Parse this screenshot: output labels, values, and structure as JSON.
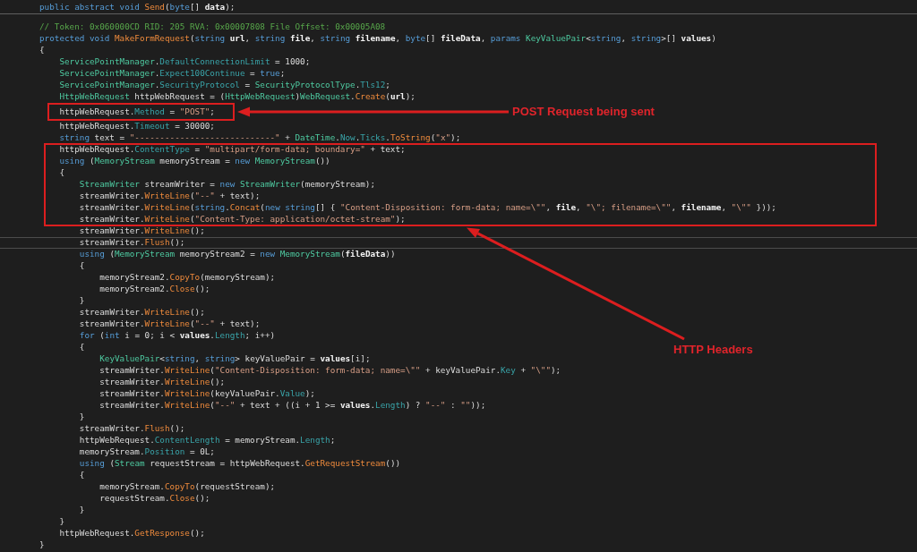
{
  "members": [
    {
      "lines": [
        {
          "tokens": [
            {
              "kind": "keyword",
              "text": "public abstract void "
            },
            {
              "kind": "method",
              "text": "Send"
            },
            {
              "kind": "plain",
              "text": "("
            },
            {
              "kind": "keyword",
              "text": "byte"
            },
            {
              "kind": "plain",
              "text": "[] "
            },
            {
              "kind": "parameter",
              "text": "data"
            },
            {
              "kind": "plain",
              "text": ");"
            }
          ],
          "current": false
        }
      ]
    },
    {
      "lines": [
        {
          "tokens": [
            {
              "kind": "comment",
              "text": "// Token: 0x060000CD RID: 205 RVA: 0x00007808 File Offset: 0x00005A08"
            }
          ],
          "current": false
        },
        {
          "tokens": [
            {
              "kind": "keyword",
              "text": "protected void "
            },
            {
              "kind": "method",
              "text": "MakeFormRequest"
            },
            {
              "kind": "plain",
              "text": "("
            },
            {
              "kind": "keyword",
              "text": "string "
            },
            {
              "kind": "parameter",
              "text": "url"
            },
            {
              "kind": "plain",
              "text": ", "
            },
            {
              "kind": "keyword",
              "text": "string "
            },
            {
              "kind": "parameter",
              "text": "file"
            },
            {
              "kind": "plain",
              "text": ", "
            },
            {
              "kind": "keyword",
              "text": "string "
            },
            {
              "kind": "parameter",
              "text": "filename"
            },
            {
              "kind": "plain",
              "text": ", "
            },
            {
              "kind": "keyword",
              "text": "byte"
            },
            {
              "kind": "plain",
              "text": "[] "
            },
            {
              "kind": "parameter",
              "text": "fileData"
            },
            {
              "kind": "plain",
              "text": ", "
            },
            {
              "kind": "keyword",
              "text": "params "
            },
            {
              "kind": "type",
              "text": "KeyValuePair"
            },
            {
              "kind": "plain",
              "text": "<"
            },
            {
              "kind": "keyword",
              "text": "string"
            },
            {
              "kind": "plain",
              "text": ", "
            },
            {
              "kind": "keyword",
              "text": "string"
            },
            {
              "kind": "plain",
              "text": ">[] "
            },
            {
              "kind": "parameter",
              "text": "values"
            },
            {
              "kind": "plain",
              "text": ")"
            }
          ],
          "current": false
        },
        {
          "tokens": [
            {
              "kind": "plain",
              "text": "{"
            }
          ],
          "current": false,
          "children": [
            {
              "tokens": [
                {
                  "kind": "type",
                  "text": "ServicePointManager"
                },
                {
                  "kind": "plain",
                  "text": "."
                },
                {
                  "kind": "property",
                  "text": "DefaultConnectionLimit"
                },
                {
                  "kind": "plain",
                  "text": " = 1000;"
                }
              ],
              "current": false
            },
            {
              "tokens": [
                {
                  "kind": "type",
                  "text": "ServicePointManager"
                },
                {
                  "kind": "plain",
                  "text": "."
                },
                {
                  "kind": "property",
                  "text": "Expect100Continue"
                },
                {
                  "kind": "plain",
                  "text": " = "
                },
                {
                  "kind": "keyword",
                  "text": "true"
                },
                {
                  "kind": "plain",
                  "text": ";"
                }
              ],
              "current": false
            },
            {
              "tokens": [
                {
                  "kind": "type",
                  "text": "ServicePointManager"
                },
                {
                  "kind": "plain",
                  "text": "."
                },
                {
                  "kind": "property",
                  "text": "SecurityProtocol"
                },
                {
                  "kind": "plain",
                  "text": " = "
                },
                {
                  "kind": "type",
                  "text": "SecurityProtocolType"
                },
                {
                  "kind": "plain",
                  "text": "."
                },
                {
                  "kind": "property",
                  "text": "Tls12"
                },
                {
                  "kind": "plain",
                  "text": ";"
                }
              ],
              "current": false
            },
            {
              "tokens": [
                {
                  "kind": "type",
                  "text": "HttpWebRequest"
                },
                {
                  "kind": "plain",
                  "text": " httpWebRequest = ("
                },
                {
                  "kind": "type",
                  "text": "HttpWebRequest"
                },
                {
                  "kind": "plain",
                  "text": ")"
                },
                {
                  "kind": "type",
                  "text": "WebRequest"
                },
                {
                  "kind": "plain",
                  "text": "."
                },
                {
                  "kind": "method",
                  "text": "Create"
                },
                {
                  "kind": "plain",
                  "text": "("
                },
                {
                  "kind": "parameter",
                  "text": "url"
                },
                {
                  "kind": "plain",
                  "text": ");"
                }
              ],
              "current": false
            },
            {
              "tokens": [
                {
                  "kind": "plain",
                  "text": "httpWebRequest."
                },
                {
                  "kind": "property",
                  "text": "Method"
                },
                {
                  "kind": "plain",
                  "text": " = "
                },
                {
                  "kind": "string",
                  "text": "\"POST\""
                },
                {
                  "kind": "plain",
                  "text": ";"
                }
              ],
              "current": false
            },
            {
              "tokens": [
                {
                  "kind": "plain",
                  "text": "httpWebRequest."
                },
                {
                  "kind": "property",
                  "text": "Timeout"
                },
                {
                  "kind": "plain",
                  "text": " = 30000;"
                }
              ],
              "current": false
            },
            {
              "tokens": [
                {
                  "kind": "keyword",
                  "text": "string"
                },
                {
                  "kind": "plain",
                  "text": " text = "
                },
                {
                  "kind": "string",
                  "text": "\"----------------------------\""
                },
                {
                  "kind": "plain",
                  "text": " + "
                },
                {
                  "kind": "type",
                  "text": "DateTime"
                },
                {
                  "kind": "plain",
                  "text": "."
                },
                {
                  "kind": "property",
                  "text": "Now"
                },
                {
                  "kind": "plain",
                  "text": "."
                },
                {
                  "kind": "property",
                  "text": "Ticks"
                },
                {
                  "kind": "plain",
                  "text": "."
                },
                {
                  "kind": "method",
                  "text": "ToString"
                },
                {
                  "kind": "plain",
                  "text": "("
                },
                {
                  "kind": "string",
                  "text": "\"x\""
                },
                {
                  "kind": "plain",
                  "text": ");"
                }
              ],
              "current": false
            },
            {
              "tokens": [
                {
                  "kind": "plain",
                  "text": "httpWebRequest."
                },
                {
                  "kind": "property",
                  "text": "ContentType"
                },
                {
                  "kind": "plain",
                  "text": " = "
                },
                {
                  "kind": "string",
                  "text": "\"multipart/form-data; boundary=\""
                },
                {
                  "kind": "plain",
                  "text": " + text;"
                }
              ],
              "current": false
            },
            {
              "tokens": [
                {
                  "kind": "keyword",
                  "text": "using"
                },
                {
                  "kind": "plain",
                  "text": " ("
                },
                {
                  "kind": "type",
                  "text": "MemoryStream"
                },
                {
                  "kind": "plain",
                  "text": " memoryStream = "
                },
                {
                  "kind": "keyword",
                  "text": "new "
                },
                {
                  "kind": "type",
                  "text": "MemoryStream"
                },
                {
                  "kind": "plain",
                  "text": "())"
                }
              ],
              "current": false
            },
            {
              "tokens": [
                {
                  "kind": "plain",
                  "text": "{"
                }
              ],
              "current": false,
              "children": [
                {
                  "tokens": [
                    {
                      "kind": "type",
                      "text": "StreamWriter"
                    },
                    {
                      "kind": "plain",
                      "text": " streamWriter = "
                    },
                    {
                      "kind": "keyword",
                      "text": "new "
                    },
                    {
                      "kind": "type",
                      "text": "StreamWriter"
                    },
                    {
                      "kind": "plain",
                      "text": "(memoryStream);"
                    }
                  ],
                  "current": false
                },
                {
                  "tokens": [
                    {
                      "kind": "plain",
                      "text": "streamWriter."
                    },
                    {
                      "kind": "method",
                      "text": "WriteLine"
                    },
                    {
                      "kind": "plain",
                      "text": "("
                    },
                    {
                      "kind": "string",
                      "text": "\"--\""
                    },
                    {
                      "kind": "plain",
                      "text": " + text);"
                    }
                  ],
                  "current": false
                },
                {
                  "tokens": [
                    {
                      "kind": "plain",
                      "text": "streamWriter."
                    },
                    {
                      "kind": "method",
                      "text": "WriteLine"
                    },
                    {
                      "kind": "plain",
                      "text": "("
                    },
                    {
                      "kind": "keyword",
                      "text": "string"
                    },
                    {
                      "kind": "plain",
                      "text": "."
                    },
                    {
                      "kind": "method",
                      "text": "Concat"
                    },
                    {
                      "kind": "plain",
                      "text": "("
                    },
                    {
                      "kind": "keyword",
                      "text": "new string"
                    },
                    {
                      "kind": "plain",
                      "text": "[] { "
                    },
                    {
                      "kind": "string",
                      "text": "\"Content-Disposition: form-data; name=\\\"\""
                    },
                    {
                      "kind": "plain",
                      "text": ", "
                    },
                    {
                      "kind": "parameter",
                      "text": "file"
                    },
                    {
                      "kind": "plain",
                      "text": ", "
                    },
                    {
                      "kind": "string",
                      "text": "\"\\\"; filename=\\\"\""
                    },
                    {
                      "kind": "plain",
                      "text": ", "
                    },
                    {
                      "kind": "parameter",
                      "text": "filename"
                    },
                    {
                      "kind": "plain",
                      "text": ", "
                    },
                    {
                      "kind": "string",
                      "text": "\"\\\"\""
                    },
                    {
                      "kind": "plain",
                      "text": " }));"
                    }
                  ],
                  "current": false
                },
                {
                  "tokens": [
                    {
                      "kind": "plain",
                      "text": "streamWriter."
                    },
                    {
                      "kind": "method",
                      "text": "WriteLine"
                    },
                    {
                      "kind": "plain",
                      "text": "("
                    },
                    {
                      "kind": "string",
                      "text": "\"Content-Type: application/octet-stream\""
                    },
                    {
                      "kind": "plain",
                      "text": ");"
                    }
                  ],
                  "current": false
                },
                {
                  "tokens": [
                    {
                      "kind": "plain",
                      "text": "streamWriter."
                    },
                    {
                      "kind": "method",
                      "text": "WriteLine"
                    },
                    {
                      "kind": "plain",
                      "text": "();"
                    }
                  ],
                  "current": false
                },
                {
                  "tokens": [
                    {
                      "kind": "plain",
                      "text": "streamWriter."
                    },
                    {
                      "kind": "method",
                      "text": "Flush"
                    },
                    {
                      "kind": "plain",
                      "text": "();"
                    }
                  ],
                  "current": true
                },
                {
                  "tokens": [
                    {
                      "kind": "keyword",
                      "text": "using"
                    },
                    {
                      "kind": "plain",
                      "text": " ("
                    },
                    {
                      "kind": "type",
                      "text": "MemoryStream"
                    },
                    {
                      "kind": "plain",
                      "text": " memoryStream2 = "
                    },
                    {
                      "kind": "keyword",
                      "text": "new "
                    },
                    {
                      "kind": "type",
                      "text": "MemoryStream"
                    },
                    {
                      "kind": "plain",
                      "text": "("
                    },
                    {
                      "kind": "parameter",
                      "text": "fileData"
                    },
                    {
                      "kind": "plain",
                      "text": "))"
                    }
                  ],
                  "current": false
                },
                {
                  "tokens": [
                    {
                      "kind": "plain",
                      "text": "{"
                    }
                  ],
                  "current": false,
                  "children": [
                    {
                      "tokens": [
                        {
                          "kind": "plain",
                          "text": "memoryStream2."
                        },
                        {
                          "kind": "method",
                          "text": "CopyTo"
                        },
                        {
                          "kind": "plain",
                          "text": "(memoryStream);"
                        }
                      ],
                      "current": false
                    },
                    {
                      "tokens": [
                        {
                          "kind": "plain",
                          "text": "memoryStream2."
                        },
                        {
                          "kind": "method",
                          "text": "Close"
                        },
                        {
                          "kind": "plain",
                          "text": "();"
                        }
                      ],
                      "current": false
                    }
                  ]
                },
                {
                  "tokens": [
                    {
                      "kind": "plain",
                      "text": "}"
                    }
                  ],
                  "current": false
                },
                {
                  "tokens": [
                    {
                      "kind": "plain",
                      "text": "streamWriter."
                    },
                    {
                      "kind": "method",
                      "text": "WriteLine"
                    },
                    {
                      "kind": "plain",
                      "text": "();"
                    }
                  ],
                  "current": false
                },
                {
                  "tokens": [
                    {
                      "kind": "plain",
                      "text": "streamWriter."
                    },
                    {
                      "kind": "method",
                      "text": "WriteLine"
                    },
                    {
                      "kind": "plain",
                      "text": "("
                    },
                    {
                      "kind": "string",
                      "text": "\"--\""
                    },
                    {
                      "kind": "plain",
                      "text": " + text);"
                    }
                  ],
                  "current": false
                },
                {
                  "tokens": [
                    {
                      "kind": "keyword",
                      "text": "for"
                    },
                    {
                      "kind": "plain",
                      "text": " ("
                    },
                    {
                      "kind": "keyword",
                      "text": "int"
                    },
                    {
                      "kind": "plain",
                      "text": " i = 0; i < "
                    },
                    {
                      "kind": "parameter",
                      "text": "values"
                    },
                    {
                      "kind": "plain",
                      "text": "."
                    },
                    {
                      "kind": "property",
                      "text": "Length"
                    },
                    {
                      "kind": "plain",
                      "text": "; i++)"
                    }
                  ],
                  "current": false
                },
                {
                  "tokens": [
                    {
                      "kind": "plain",
                      "text": "{"
                    }
                  ],
                  "current": false,
                  "children": [
                    {
                      "tokens": [
                        {
                          "kind": "type",
                          "text": "KeyValuePair"
                        },
                        {
                          "kind": "plain",
                          "text": "<"
                        },
                        {
                          "kind": "keyword",
                          "text": "string"
                        },
                        {
                          "kind": "plain",
                          "text": ", "
                        },
                        {
                          "kind": "keyword",
                          "text": "string"
                        },
                        {
                          "kind": "plain",
                          "text": "> keyValuePair = "
                        },
                        {
                          "kind": "parameter",
                          "text": "values"
                        },
                        {
                          "kind": "plain",
                          "text": "[i];"
                        }
                      ],
                      "current": false
                    },
                    {
                      "tokens": [
                        {
                          "kind": "plain",
                          "text": "streamWriter."
                        },
                        {
                          "kind": "method",
                          "text": "WriteLine"
                        },
                        {
                          "kind": "plain",
                          "text": "("
                        },
                        {
                          "kind": "string",
                          "text": "\"Content-Disposition: form-data; name=\\\"\""
                        },
                        {
                          "kind": "plain",
                          "text": " + keyValuePair."
                        },
                        {
                          "kind": "property",
                          "text": "Key"
                        },
                        {
                          "kind": "plain",
                          "text": " + "
                        },
                        {
                          "kind": "string",
                          "text": "\"\\\"\""
                        },
                        {
                          "kind": "plain",
                          "text": ");"
                        }
                      ],
                      "current": false
                    },
                    {
                      "tokens": [
                        {
                          "kind": "plain",
                          "text": "streamWriter."
                        },
                        {
                          "kind": "method",
                          "text": "WriteLine"
                        },
                        {
                          "kind": "plain",
                          "text": "();"
                        }
                      ],
                      "current": false
                    },
                    {
                      "tokens": [
                        {
                          "kind": "plain",
                          "text": "streamWriter."
                        },
                        {
                          "kind": "method",
                          "text": "WriteLine"
                        },
                        {
                          "kind": "plain",
                          "text": "(keyValuePair."
                        },
                        {
                          "kind": "property",
                          "text": "Value"
                        },
                        {
                          "kind": "plain",
                          "text": ");"
                        }
                      ],
                      "current": false
                    },
                    {
                      "tokens": [
                        {
                          "kind": "plain",
                          "text": "streamWriter."
                        },
                        {
                          "kind": "method",
                          "text": "WriteLine"
                        },
                        {
                          "kind": "plain",
                          "text": "("
                        },
                        {
                          "kind": "string",
                          "text": "\"--\""
                        },
                        {
                          "kind": "plain",
                          "text": " + text + ((i + 1 >= "
                        },
                        {
                          "kind": "parameter",
                          "text": "values"
                        },
                        {
                          "kind": "plain",
                          "text": "."
                        },
                        {
                          "kind": "property",
                          "text": "Length"
                        },
                        {
                          "kind": "plain",
                          "text": ") ? "
                        },
                        {
                          "kind": "string",
                          "text": "\"--\""
                        },
                        {
                          "kind": "plain",
                          "text": " : "
                        },
                        {
                          "kind": "string",
                          "text": "\"\""
                        },
                        {
                          "kind": "plain",
                          "text": "));"
                        }
                      ],
                      "current": false
                    }
                  ]
                },
                {
                  "tokens": [
                    {
                      "kind": "plain",
                      "text": "}"
                    }
                  ],
                  "current": false
                },
                {
                  "tokens": [
                    {
                      "kind": "plain",
                      "text": "streamWriter."
                    },
                    {
                      "kind": "method",
                      "text": "Flush"
                    },
                    {
                      "kind": "plain",
                      "text": "();"
                    }
                  ],
                  "current": false
                },
                {
                  "tokens": [
                    {
                      "kind": "plain",
                      "text": "httpWebRequest."
                    },
                    {
                      "kind": "property",
                      "text": "ContentLength"
                    },
                    {
                      "kind": "plain",
                      "text": " = memoryStream."
                    },
                    {
                      "kind": "property",
                      "text": "Length"
                    },
                    {
                      "kind": "plain",
                      "text": ";"
                    }
                  ],
                  "current": false
                },
                {
                  "tokens": [
                    {
                      "kind": "plain",
                      "text": "memoryStream."
                    },
                    {
                      "kind": "property",
                      "text": "Position"
                    },
                    {
                      "kind": "plain",
                      "text": " = 0L;"
                    }
                  ],
                  "current": false
                },
                {
                  "tokens": [
                    {
                      "kind": "keyword",
                      "text": "using"
                    },
                    {
                      "kind": "plain",
                      "text": " ("
                    },
                    {
                      "kind": "type",
                      "text": "Stream"
                    },
                    {
                      "kind": "plain",
                      "text": " requestStream = httpWebRequest."
                    },
                    {
                      "kind": "method",
                      "text": "GetRequestStream"
                    },
                    {
                      "kind": "plain",
                      "text": "())"
                    }
                  ],
                  "current": false
                },
                {
                  "tokens": [
                    {
                      "kind": "plain",
                      "text": "{"
                    }
                  ],
                  "current": false,
                  "children": [
                    {
                      "tokens": [
                        {
                          "kind": "plain",
                          "text": "memoryStream."
                        },
                        {
                          "kind": "method",
                          "text": "CopyTo"
                        },
                        {
                          "kind": "plain",
                          "text": "(requestStream);"
                        }
                      ],
                      "current": false
                    },
                    {
                      "tokens": [
                        {
                          "kind": "plain",
                          "text": "requestStream."
                        },
                        {
                          "kind": "method",
                          "text": "Close"
                        },
                        {
                          "kind": "plain",
                          "text": "();"
                        }
                      ],
                      "current": false
                    }
                  ]
                },
                {
                  "tokens": [
                    {
                      "kind": "plain",
                      "text": "}"
                    }
                  ],
                  "current": false
                }
              ]
            },
            {
              "tokens": [
                {
                  "kind": "plain",
                  "text": "}"
                }
              ],
              "current": false
            },
            {
              "tokens": [
                {
                  "kind": "plain",
                  "text": "httpWebRequest."
                },
                {
                  "kind": "method",
                  "text": "GetResponse"
                },
                {
                  "kind": "plain",
                  "text": "();"
                }
              ],
              "current": false
            }
          ]
        },
        {
          "tokens": [
            {
              "kind": "plain",
              "text": "}"
            }
          ],
          "current": false
        }
      ]
    }
  ],
  "annotations": [
    {
      "label": "POST Request being sent"
    },
    {
      "label": "HTTP Headers"
    }
  ]
}
